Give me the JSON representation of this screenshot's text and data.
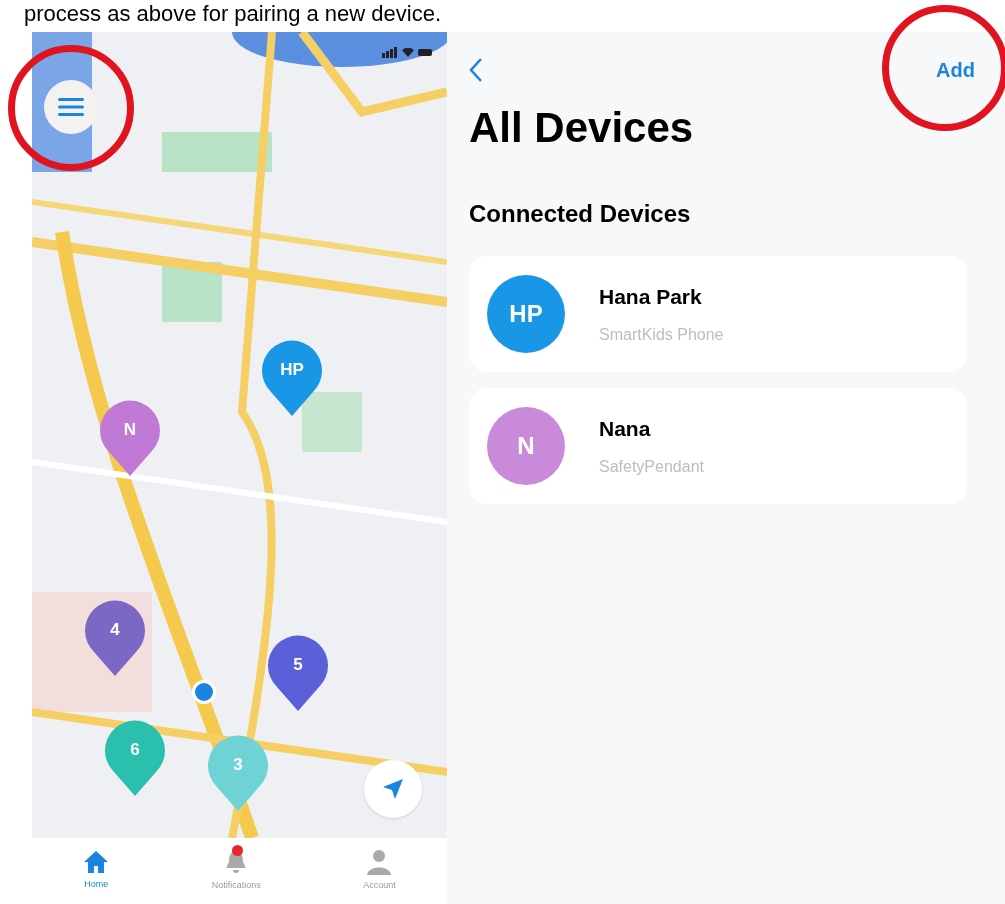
{
  "caption": "process as above for pairing a new device.",
  "map_screen": {
    "pins": [
      {
        "label": "HP",
        "color": "#1a96e6"
      },
      {
        "label": "N",
        "color": "#c07ad6"
      },
      {
        "label": "4",
        "color": "#7b68c4"
      },
      {
        "label": "5",
        "color": "#5b5fd8"
      },
      {
        "label": "6",
        "color": "#2bbfae"
      },
      {
        "label": "3",
        "color": "#6fd3d6"
      }
    ],
    "tabs": [
      {
        "label": "Home",
        "selected": true,
        "badge": false
      },
      {
        "label": "Notifications",
        "selected": false,
        "badge": true
      },
      {
        "label": "Account",
        "selected": false,
        "badge": false
      }
    ]
  },
  "devices_screen": {
    "add_button": "Add",
    "title": "All Devices",
    "section": "Connected Devices",
    "devices": [
      {
        "initials": "HP",
        "name": "Hana Park",
        "type": "SmartKids Phone",
        "color": "#1a96e6"
      },
      {
        "initials": "N",
        "name": "Nana",
        "type": "SafetyPendant",
        "color": "#c98ad9"
      }
    ]
  }
}
